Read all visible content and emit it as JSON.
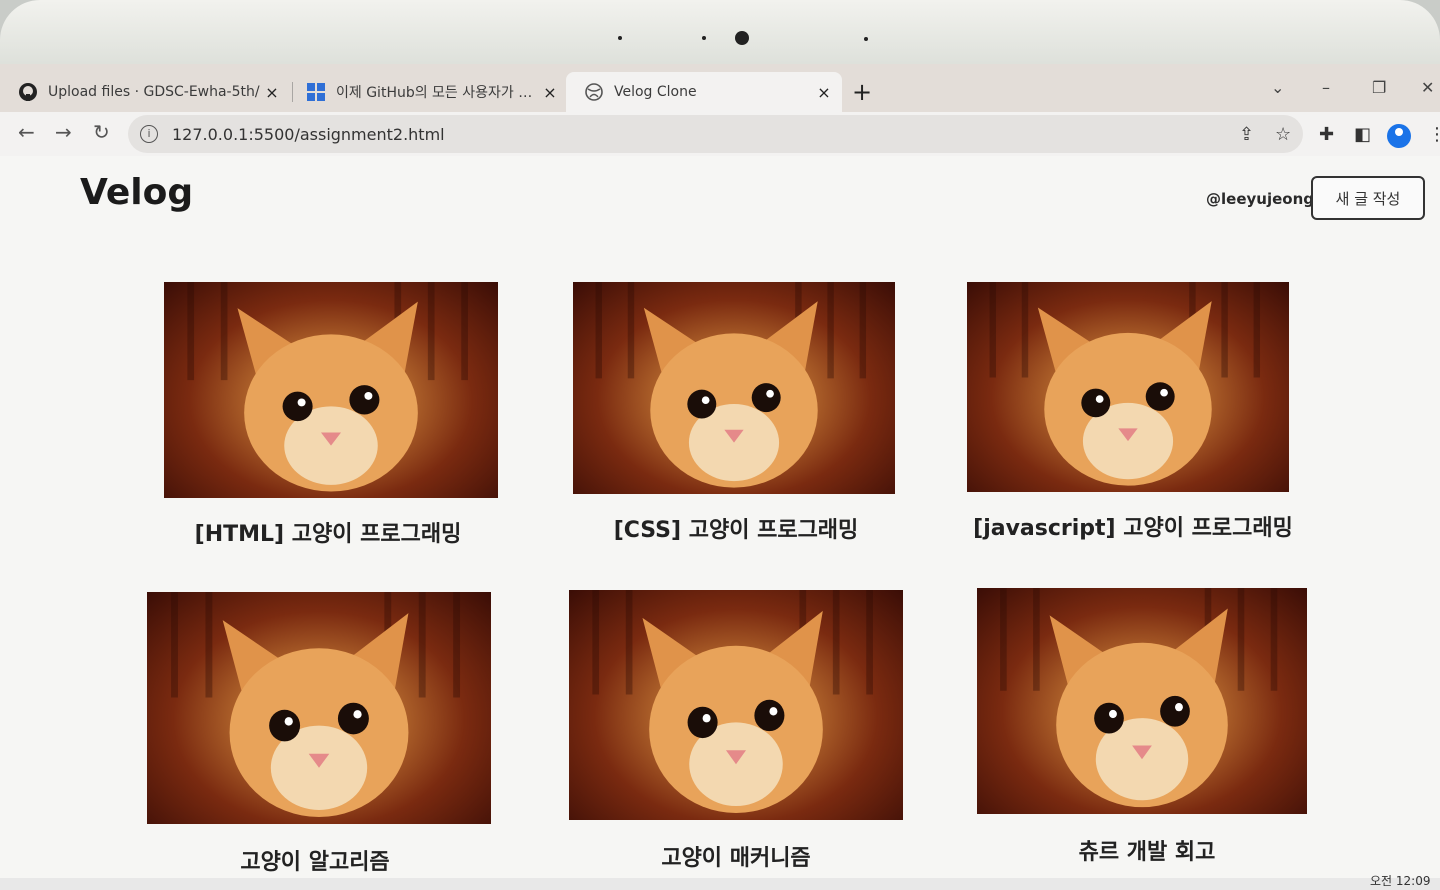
{
  "browser": {
    "tabs": [
      {
        "label": "Upload files · GDSC-Ewha-5th/",
        "close": "×",
        "icon": "github-icon"
      },
      {
        "label": "이제 GitHub의 모든 사용자가 …",
        "close": "×",
        "icon": "windows-icon"
      },
      {
        "label": "Velog Clone",
        "close": "×",
        "icon": "globe-icon"
      }
    ],
    "new_tab": "+",
    "url": "127.0.0.1:5500/assignment2.html"
  },
  "header": {
    "logo": "Velog",
    "username": "@leeyujeong",
    "write_button": "새 글 작성"
  },
  "posts": [
    {
      "title": "[HTML] 고양이 프로그래밍"
    },
    {
      "title": "[CSS] 고양이 프로그래밍"
    },
    {
      "title": "[javascript] 고양이 프로그래밍"
    },
    {
      "title": "고양이 알고리즘"
    },
    {
      "title": "고양이 매커니즘"
    },
    {
      "title": "츄르 개발 회고"
    }
  ],
  "system": {
    "clock": "오전 12:09"
  },
  "colors": {
    "accent": "#1a73e8",
    "thumb_fur": "#e8a35a",
    "thumb_bg": "#7a2a10"
  }
}
